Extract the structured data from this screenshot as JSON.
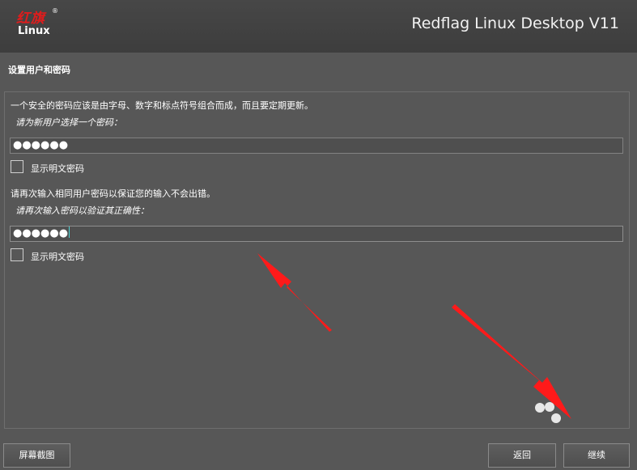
{
  "header": {
    "logo_script": "红旗",
    "logo_registered": "®",
    "logo_text": "Linux",
    "product_name": "Redflag Linux Desktop V11"
  },
  "section_title": "设置用户和密码",
  "form": {
    "intro": "一个安全的密码应该是由字母、数字和标点符号组合而成，而且要定期更新。",
    "password_prompt": "请为新用户选择一个密码：",
    "password_value": "●●●●●●",
    "show_password_label_1": "显示明文密码",
    "confirm_intro": "请再次输入相同用户密码以保证您的输入不会出错。",
    "confirm_prompt": "请再次输入密码以验证其正确性：",
    "confirm_value": "●●●●●●",
    "show_password_label_2": "显示明文密码"
  },
  "buttons": {
    "screenshot": "屏幕截图",
    "back": "返回",
    "continue": "继续"
  },
  "colors": {
    "background": "#575757",
    "header": "#474747",
    "annotation_arrow": "#ff1a1a",
    "logo_red": "#e01c1c"
  }
}
